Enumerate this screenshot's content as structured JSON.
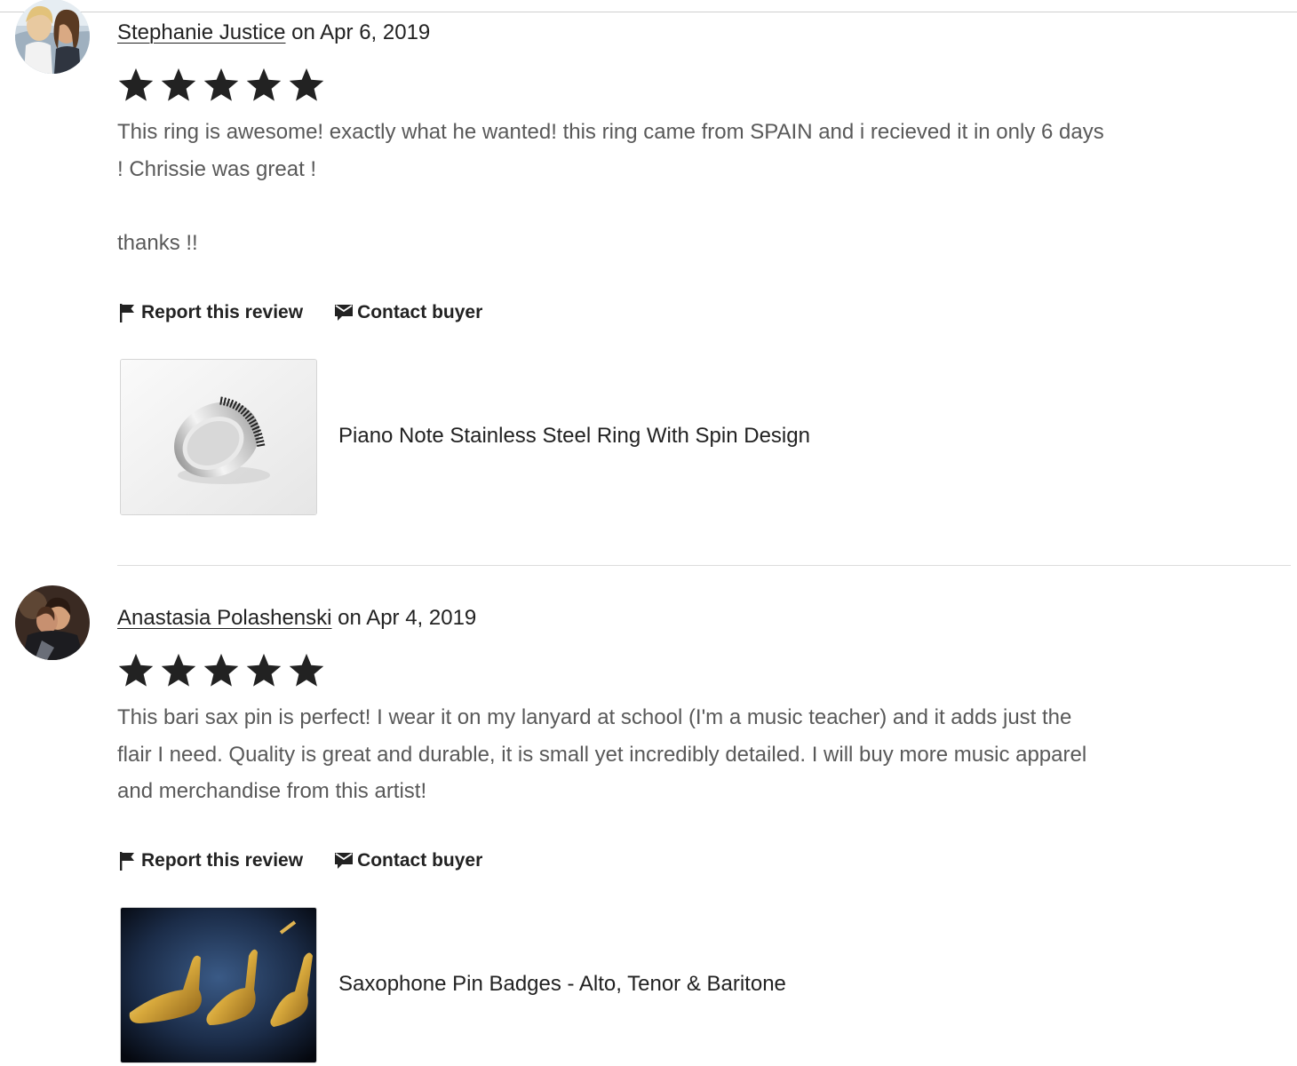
{
  "reviews": [
    {
      "reviewer": "Stephanie Justice",
      "date_text": " on Apr 6, 2019",
      "rating": 5,
      "text": "This ring is awesome! exactly what he wanted! this ring came from SPAIN and i recieved it in only 6 days\n! Chrissie was great !\n\nthanks !!",
      "actions": {
        "report": "Report this review",
        "contact": "Contact buyer"
      },
      "product": {
        "title": "Piano Note Stainless Steel Ring With Spin Design"
      }
    },
    {
      "reviewer": "Anastasia Polashenski",
      "date_text": " on Apr 4, 2019",
      "rating": 5,
      "text": "This bari sax pin is perfect! I wear it on my lanyard at school (I'm a music teacher) and it adds just the\nflair I need. Quality is great and durable, it is small yet incredibly detailed. I will buy more music apparel\nand merchandise from this artist!",
      "actions": {
        "report": "Report this review",
        "contact": "Contact buyer"
      },
      "product": {
        "title": "Saxophone Pin Badges - Alto, Tenor & Baritone"
      }
    }
  ],
  "icons": {
    "star": "star-icon",
    "report": "flag-icon",
    "contact": "message-icon"
  },
  "colors": {
    "star": "#222222",
    "body_text": "#595959",
    "heading_text": "#222222",
    "divider": "#dcdcdc"
  }
}
